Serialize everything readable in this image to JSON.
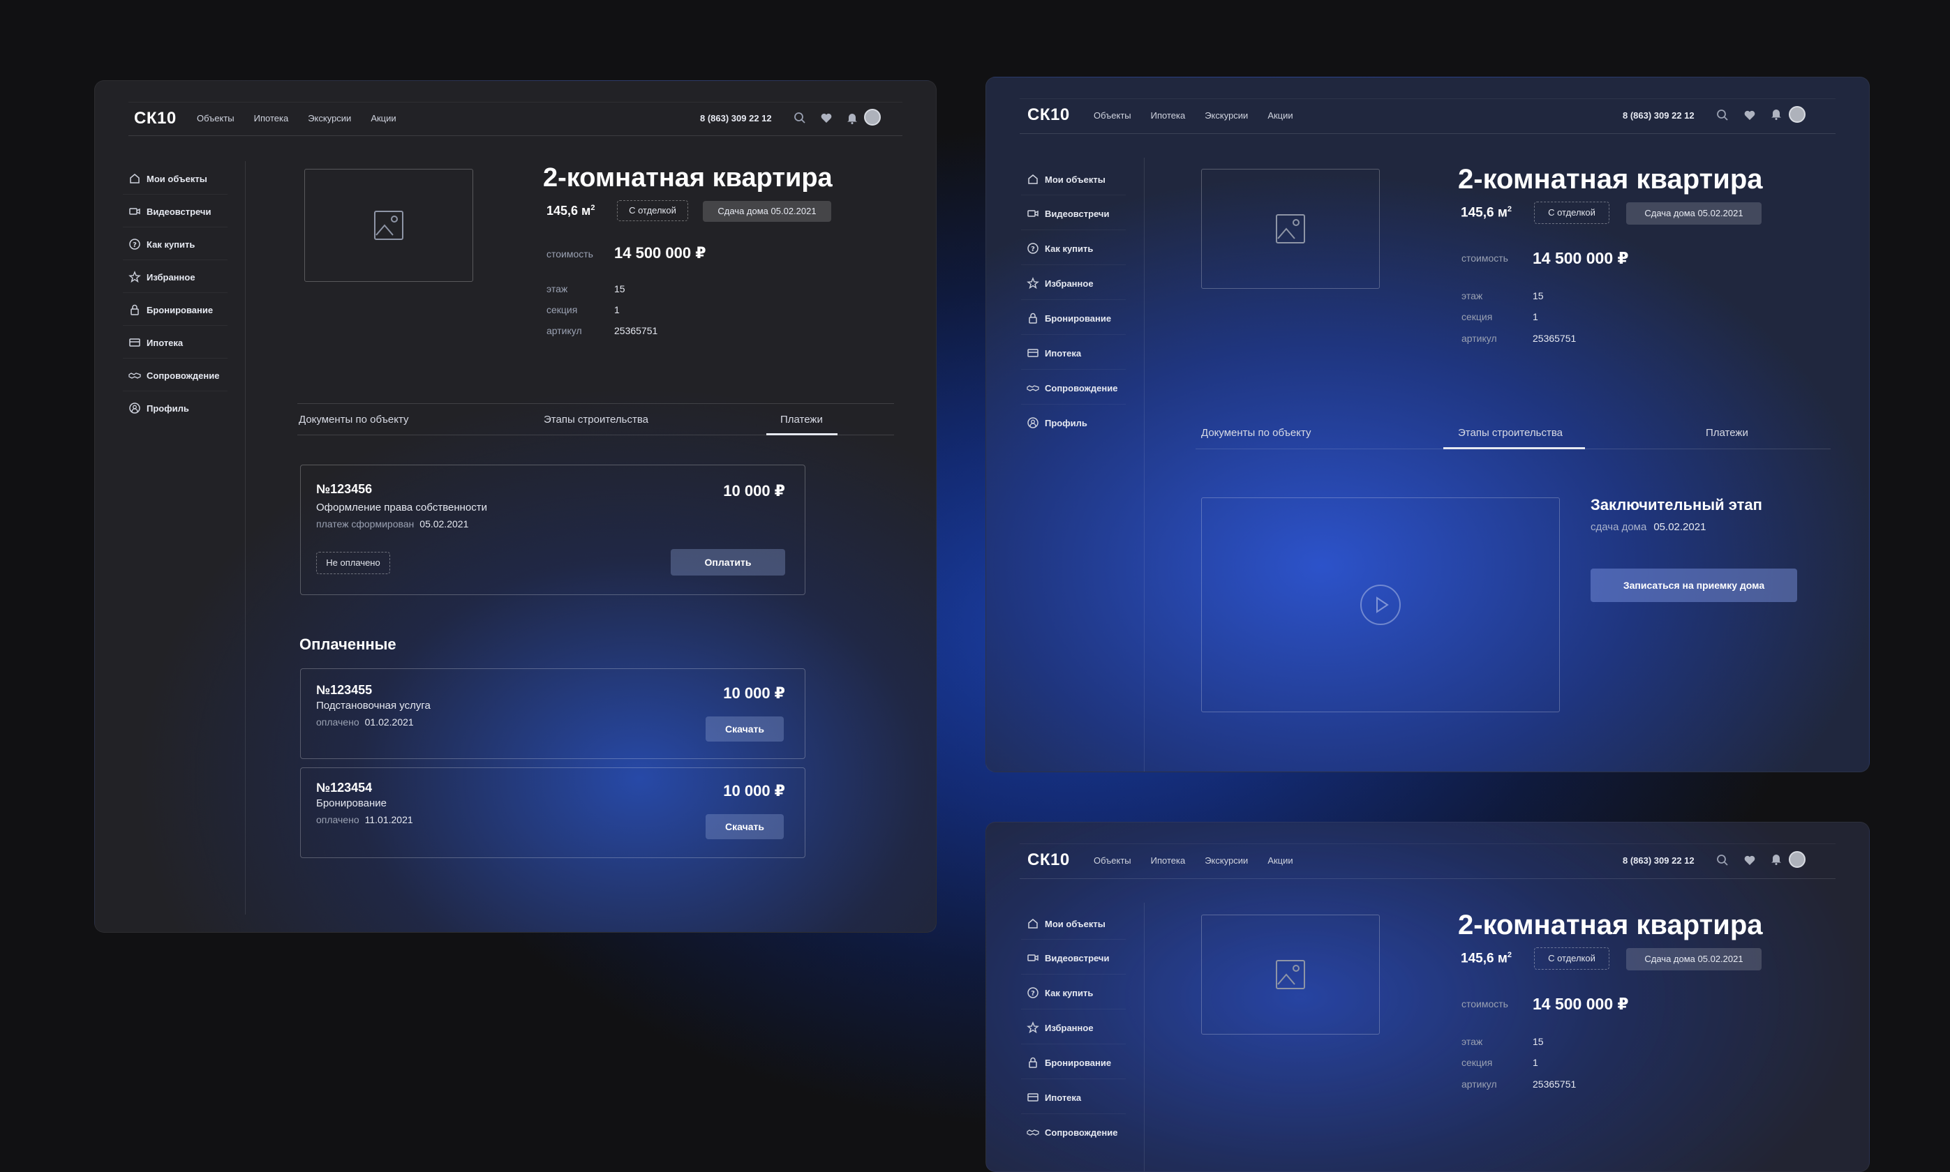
{
  "header": {
    "logo": "СК10",
    "nav": [
      "Объекты",
      "Ипотека",
      "Экскурсии",
      "Акции"
    ],
    "phone": "8 (863) 309 22 12"
  },
  "sidebar": {
    "items": [
      {
        "label": "Мои объекты",
        "icon": "home-icon"
      },
      {
        "label": "Видеовстречи",
        "icon": "video-camera-icon"
      },
      {
        "label": "Как купить",
        "icon": "question-icon"
      },
      {
        "label": "Избранное",
        "icon": "star-icon"
      },
      {
        "label": "Бронирование",
        "icon": "lock-icon"
      },
      {
        "label": "Ипотека",
        "icon": "card-icon"
      },
      {
        "label": "Сопровождение",
        "icon": "handshake-icon"
      },
      {
        "label": "Профиль",
        "icon": "profile-icon"
      }
    ]
  },
  "object": {
    "title": "2-комнатная квартира",
    "area": "145,6 м",
    "area_sup": "2",
    "chip_finish": "С отделкой",
    "chip_delivery": "Сдача дома 05.02.2021",
    "price_label": "стоимость",
    "price": "14 500 000 ₽",
    "floor_label": "этаж",
    "floor": "15",
    "section_label": "секция",
    "section": "1",
    "article_label": "артикул",
    "article": "25365751"
  },
  "tabs": [
    "Документы по объекту",
    "Этапы строительства",
    "Платежи"
  ],
  "payments": {
    "pending": {
      "number": "№123456",
      "amount": "10 000 ₽",
      "description": "Оформление права собственности",
      "meta_label": "платеж сформирован",
      "meta_date": "05.02.2021",
      "status": "Не оплачено",
      "button": "Оплатить"
    },
    "paid_title": "Оплаченные",
    "paid": [
      {
        "number": "№123455",
        "amount": "10 000 ₽",
        "description": "Подстановочная услуга",
        "meta_label": "оплачено",
        "meta_date": "01.02.2021",
        "button": "Скачать"
      },
      {
        "number": "№123454",
        "amount": "10 000 ₽",
        "description": "Бронирование",
        "meta_label": "оплачено",
        "meta_date": "11.01.2021",
        "button": "Скачать"
      }
    ]
  },
  "stage": {
    "title": "Заключительный этап",
    "meta_label": "сдача дома",
    "meta_date": "05.02.2021",
    "button": "Записаться на приемку дома"
  }
}
